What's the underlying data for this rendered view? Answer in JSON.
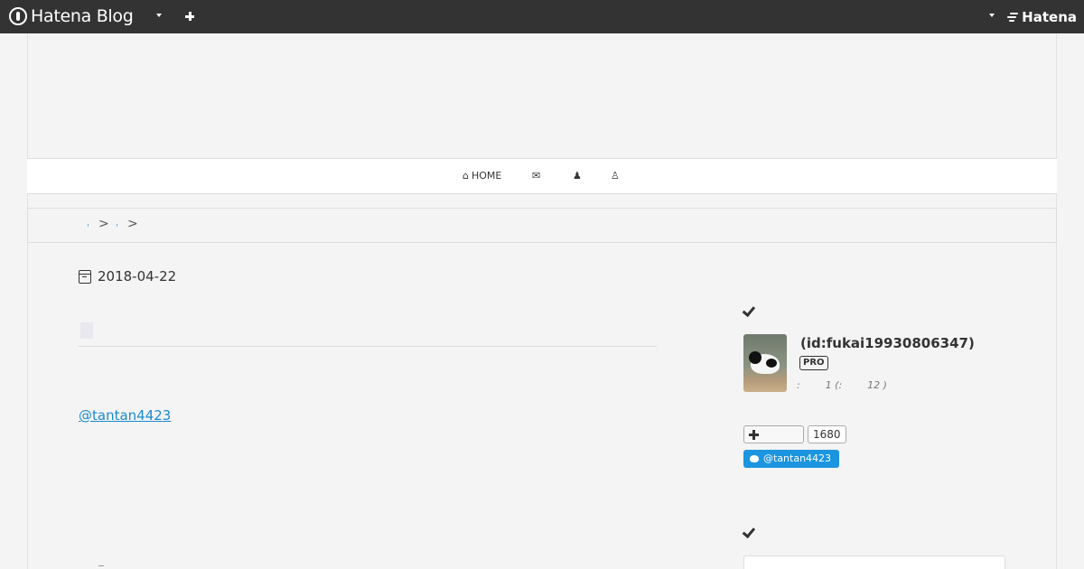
{
  "global_header": {
    "logo_text": "Hatena Blog",
    "brand_text": "Hatena"
  },
  "nav": {
    "home_label": "HOME",
    "icons": [
      "home-icon",
      "envelope-icon",
      "user-group-icon",
      "person-icon"
    ]
  },
  "breadcrumb": {
    "links": [
      "ˌ",
      "ˌ"
    ],
    "separator": ">"
  },
  "article": {
    "date": "2018-04-22",
    "mention": "@tantan4423"
  },
  "sidebar": {
    "profile": {
      "id": "(id:fukai19930806347)",
      "badge": "PRO",
      "meta": ":        1 (:        12 )"
    },
    "bookmark": {
      "count": "1680"
    },
    "twitter": {
      "follow_label": "@tantan4423"
    }
  },
  "colors": {
    "header_bg": "#333333",
    "page_bg": "#f4f4f4",
    "link": "#1a8bd1",
    "twitter": "#1b95e0"
  }
}
